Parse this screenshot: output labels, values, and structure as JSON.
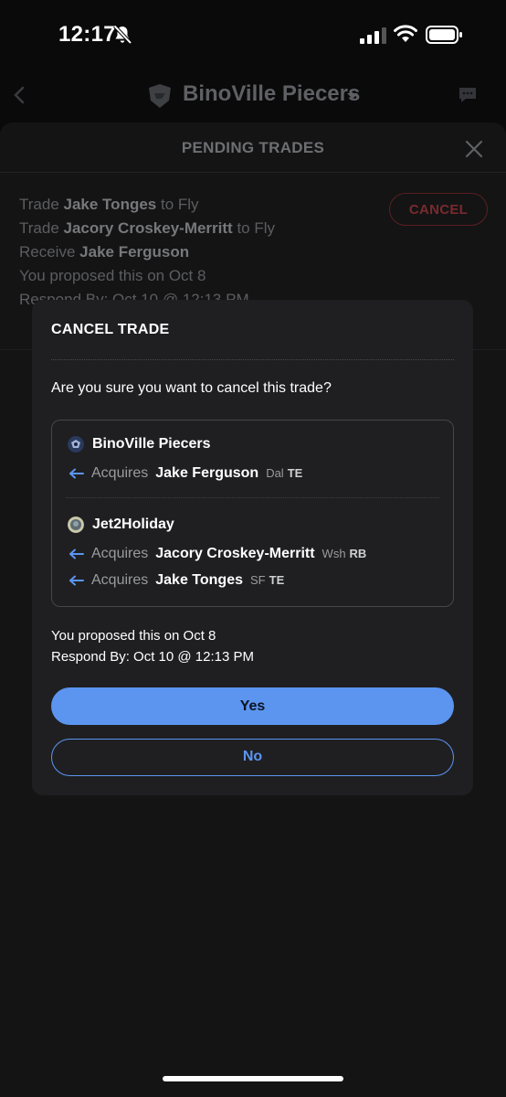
{
  "status_bar": {
    "time": "12:17"
  },
  "header": {
    "team_name": "BinoVille Piecers"
  },
  "sheet": {
    "title": "PENDING TRADES",
    "cancel_label": "CANCEL",
    "lines": [
      {
        "prefix": "Trade",
        "player": "Jake Tonges",
        "suffix": "to Fly"
      },
      {
        "prefix": "Trade",
        "player": "Jacory Croskey-Merritt",
        "suffix": "to Fly"
      },
      {
        "prefix": "Receive",
        "player": "Jake Ferguson",
        "suffix": ""
      }
    ],
    "proposed": "You proposed this on Oct 8",
    "respond_by": "Respond By: Oct 10 @ 12:13 PM"
  },
  "modal": {
    "title": "CANCEL TRADE",
    "question": "Are you sure you want to cancel this trade?",
    "teams": [
      {
        "name": "BinoVille Piecers",
        "acquisitions": [
          {
            "verb": "Acquires",
            "player": "Jake Ferguson",
            "team": "Dal",
            "pos": "TE"
          }
        ]
      },
      {
        "name": "Jet2Holiday",
        "acquisitions": [
          {
            "verb": "Acquires",
            "player": "Jacory Croskey-Merritt",
            "team": "Wsh",
            "pos": "RB"
          },
          {
            "verb": "Acquires",
            "player": "Jake Tonges",
            "team": "SF",
            "pos": "TE"
          }
        ]
      }
    ],
    "proposed": "You proposed this on Oct 8",
    "respond_by": "Respond By: Oct 10 @ 12:13 PM",
    "yes_label": "Yes",
    "no_label": "No"
  },
  "colors": {
    "accent": "#5b95f0",
    "cancel_red": "#7a2a2d",
    "modal_bg": "#1f1f22"
  },
  "icons": [
    "bell-slash-icon",
    "signal-icon",
    "wifi-icon",
    "battery-icon",
    "back-chevron-icon",
    "team-logo-icon",
    "caret-down-icon",
    "chat-icon",
    "close-icon",
    "arrow-left-icon"
  ]
}
